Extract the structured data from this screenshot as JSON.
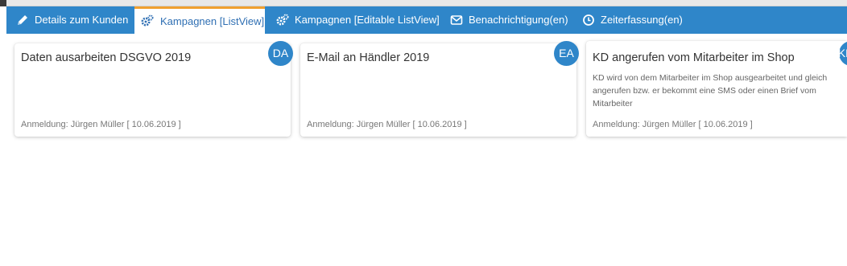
{
  "tabs": [
    {
      "label": "Details zum Kunden",
      "icon": "pencil-icon"
    },
    {
      "label": "Kampagnen [ListView]",
      "icon": "gears-icon",
      "active": true
    },
    {
      "label": "Kampagnen [Editable ListView]",
      "icon": "gears-icon"
    },
    {
      "label": "Benachrichtigung(en)",
      "icon": "envelope-icon"
    },
    {
      "label": "Zeiterfassung(en)",
      "icon": "clock-icon"
    }
  ],
  "cards": [
    {
      "title": "Daten ausarbeiten DSGVO 2019",
      "badge": "DA",
      "description": "",
      "meta": "Anmeldung: Jürgen Müller [ 10.06.2019 ]"
    },
    {
      "title": "E-Mail an Händler 2019",
      "badge": "EA",
      "description": "",
      "meta": "Anmeldung: Jürgen Müller [ 10.06.2019 ]"
    },
    {
      "title": "KD angerufen vom Mitarbeiter im Shop",
      "badge": "KD",
      "description": "KD wird von dem Mitarbeiter im Shop ausgearbeitet und gleich angerufen bzw. er bekommt eine SMS oder einen Brief vom Mitarbeiter",
      "meta": "Anmeldung: Jürgen Müller [ 10.06.2019 ]"
    }
  ],
  "colors": {
    "tabbar": "#2f86c9",
    "active_tab_border": "#f0a030",
    "badge": "#2f86c9"
  }
}
